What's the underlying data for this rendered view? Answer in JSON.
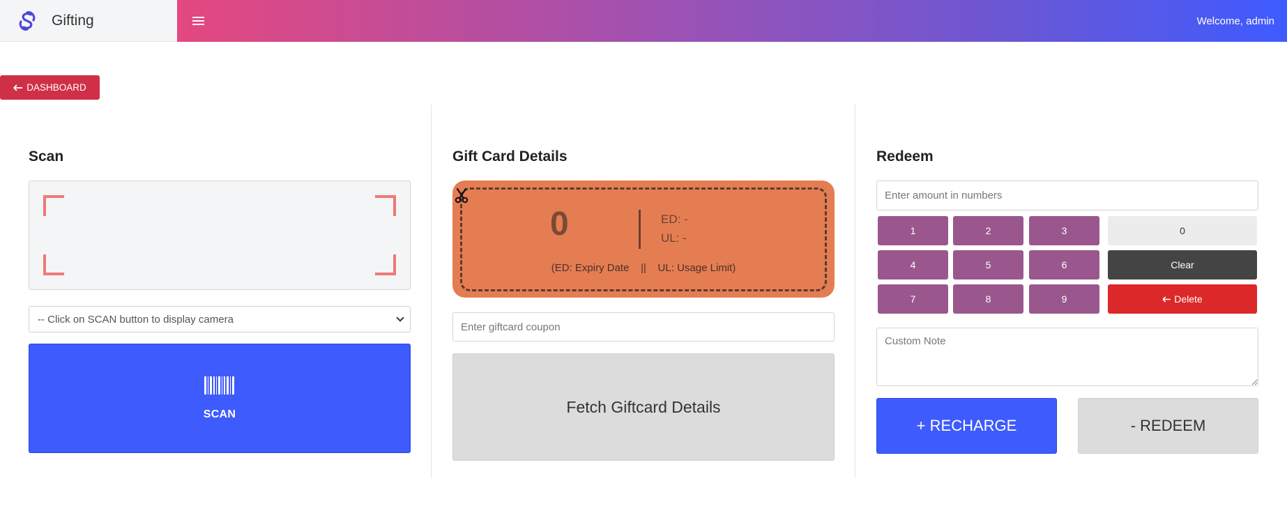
{
  "app": {
    "name": "Gifting",
    "welcome": "Welcome, admin"
  },
  "nav": {
    "dashboard_label": "DASHBOARD"
  },
  "scan": {
    "title": "Scan",
    "camera_select": {
      "selected": "-- Click on SCAN button to display camera"
    },
    "scan_button_label": "SCAN"
  },
  "giftcard": {
    "title": "Gift Card Details",
    "value": "0",
    "ed": "ED: -",
    "ul": "UL: -",
    "legend": "(ED: Expiry Date    ||    UL: Usage Limit)",
    "coupon_placeholder": "Enter giftcard coupon",
    "fetch_label": "Fetch Giftcard Details"
  },
  "redeem": {
    "title": "Redeem",
    "amount_placeholder": "Enter amount in numbers",
    "keys": [
      "1",
      "2",
      "3",
      "4",
      "5",
      "6",
      "7",
      "8",
      "9"
    ],
    "zero_label": "0",
    "clear_label": "Clear",
    "delete_label": "Delete",
    "note_placeholder": "Custom Note",
    "recharge_label": "+ RECHARGE",
    "redeem_label": "- REDEEM"
  },
  "colors": {
    "accent_blue": "#3e5bfd",
    "danger_red": "#d03047",
    "keypad_purple": "#9a578d",
    "card_orange": "#e57d53",
    "scan_corner": "#f07878"
  },
  "icons": [
    "brand-logo-icon",
    "menu-icon",
    "arrow-left-icon",
    "barcode-icon",
    "scissors-icon",
    "chevron-down-icon"
  ]
}
